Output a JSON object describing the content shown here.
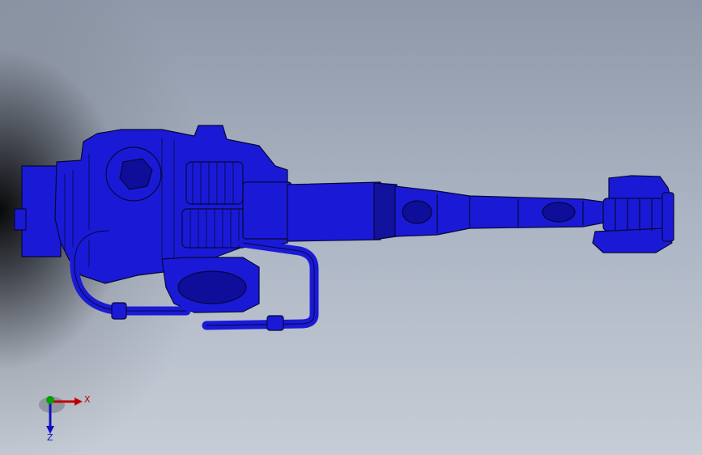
{
  "viewport": {
    "model_color": "#1a1ad6",
    "outline_color": "#06063a"
  },
  "triad": {
    "x_label": "X",
    "z_label": "Z",
    "x_color": "#c00000",
    "y_color": "#00a000",
    "z_color": "#1010c0"
  }
}
